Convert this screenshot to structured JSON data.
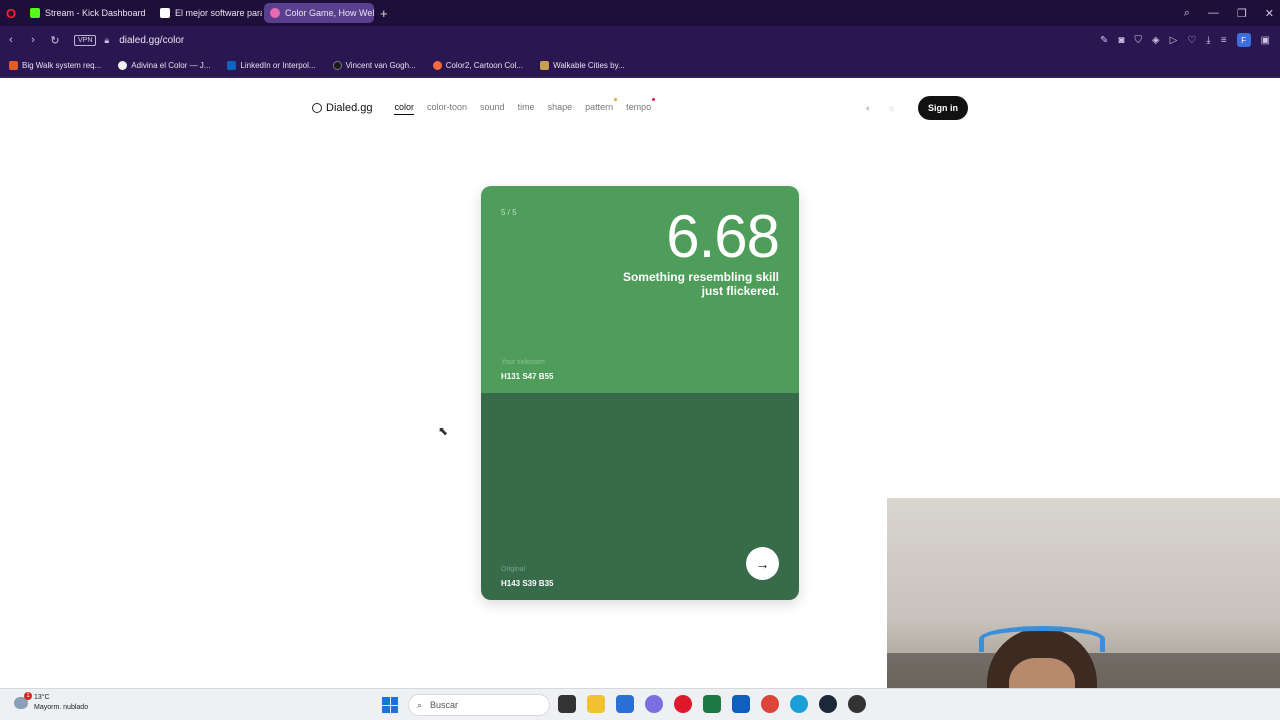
{
  "browser": {
    "tabs": [
      {
        "label": "Stream - Kick Dashboard",
        "color": "#53fc18",
        "active": false
      },
      {
        "label": "El mejor software para pc",
        "color": "#ffffff",
        "active": false
      },
      {
        "label": "Color Game, How Well Co",
        "color": "#e86ab0",
        "active": true
      }
    ],
    "new_tab": "+",
    "url": "dialed.gg/color",
    "vpn": "VPN",
    "profile": "F",
    "bookmarks": [
      {
        "label": "Big Walk system req...",
        "color": "#e25c2c"
      },
      {
        "label": "Adivina el Color — J...",
        "color": "#f0f0f0"
      },
      {
        "label": "LinkedIn or Interpol...",
        "color": "#0a66c2"
      },
      {
        "label": "Vincent van Gogh...",
        "color": "#1a1a1a"
      },
      {
        "label": "Color2, Cartoon Col...",
        "color": "#ff6a3d"
      },
      {
        "label": "Walkable Cities by...",
        "color": "#c9a050"
      }
    ]
  },
  "site": {
    "brand": "Dialed.gg",
    "nav": [
      {
        "label": "color",
        "active": true
      },
      {
        "label": "color-toon",
        "active": false
      },
      {
        "label": "sound",
        "active": false
      },
      {
        "label": "time",
        "active": false
      },
      {
        "label": "shape",
        "active": false
      },
      {
        "label": "pattern",
        "active": false
      },
      {
        "label": "tempo",
        "active": false
      }
    ],
    "signin": "Sign in"
  },
  "result": {
    "counter": "5 / 5",
    "score": "6.68",
    "message": "Something resembling skill just flickered.",
    "selection_label": "Your selection",
    "selection_value": "H131 S47 B55",
    "selection_color": "#4f9d5a",
    "original_label": "Original",
    "original_value": "H143 S39 B35",
    "original_color": "#376b49"
  },
  "taskbar": {
    "temperature": "13°C",
    "condition": "Mayorm. nublado",
    "notification_count": "1",
    "search_placeholder": "Buscar"
  }
}
